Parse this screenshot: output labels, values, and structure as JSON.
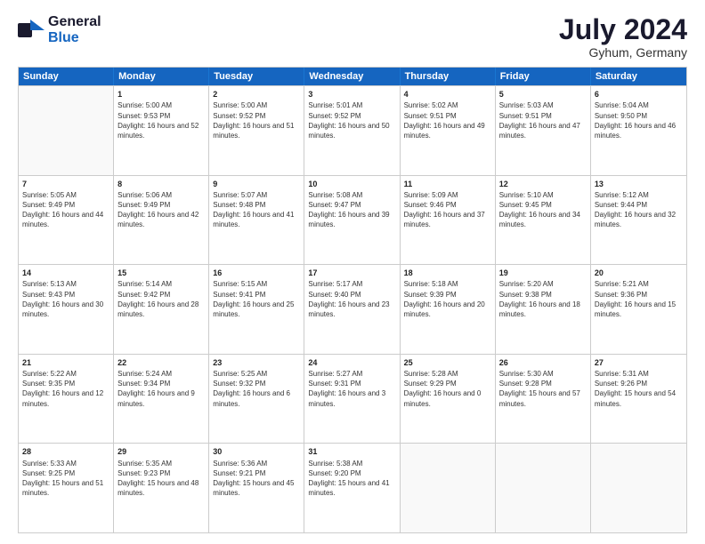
{
  "header": {
    "logo_general": "General",
    "logo_blue": "Blue",
    "month_title": "July 2024",
    "location": "Gyhum, Germany"
  },
  "weekdays": [
    "Sunday",
    "Monday",
    "Tuesday",
    "Wednesday",
    "Thursday",
    "Friday",
    "Saturday"
  ],
  "rows": [
    [
      {
        "day": "",
        "sunrise": "",
        "sunset": "",
        "daylight": "",
        "empty": true
      },
      {
        "day": "1",
        "sunrise": "Sunrise: 5:00 AM",
        "sunset": "Sunset: 9:53 PM",
        "daylight": "Daylight: 16 hours and 52 minutes."
      },
      {
        "day": "2",
        "sunrise": "Sunrise: 5:00 AM",
        "sunset": "Sunset: 9:52 PM",
        "daylight": "Daylight: 16 hours and 51 minutes."
      },
      {
        "day": "3",
        "sunrise": "Sunrise: 5:01 AM",
        "sunset": "Sunset: 9:52 PM",
        "daylight": "Daylight: 16 hours and 50 minutes."
      },
      {
        "day": "4",
        "sunrise": "Sunrise: 5:02 AM",
        "sunset": "Sunset: 9:51 PM",
        "daylight": "Daylight: 16 hours and 49 minutes."
      },
      {
        "day": "5",
        "sunrise": "Sunrise: 5:03 AM",
        "sunset": "Sunset: 9:51 PM",
        "daylight": "Daylight: 16 hours and 47 minutes."
      },
      {
        "day": "6",
        "sunrise": "Sunrise: 5:04 AM",
        "sunset": "Sunset: 9:50 PM",
        "daylight": "Daylight: 16 hours and 46 minutes."
      }
    ],
    [
      {
        "day": "7",
        "sunrise": "Sunrise: 5:05 AM",
        "sunset": "Sunset: 9:49 PM",
        "daylight": "Daylight: 16 hours and 44 minutes."
      },
      {
        "day": "8",
        "sunrise": "Sunrise: 5:06 AM",
        "sunset": "Sunset: 9:49 PM",
        "daylight": "Daylight: 16 hours and 42 minutes."
      },
      {
        "day": "9",
        "sunrise": "Sunrise: 5:07 AM",
        "sunset": "Sunset: 9:48 PM",
        "daylight": "Daylight: 16 hours and 41 minutes."
      },
      {
        "day": "10",
        "sunrise": "Sunrise: 5:08 AM",
        "sunset": "Sunset: 9:47 PM",
        "daylight": "Daylight: 16 hours and 39 minutes."
      },
      {
        "day": "11",
        "sunrise": "Sunrise: 5:09 AM",
        "sunset": "Sunset: 9:46 PM",
        "daylight": "Daylight: 16 hours and 37 minutes."
      },
      {
        "day": "12",
        "sunrise": "Sunrise: 5:10 AM",
        "sunset": "Sunset: 9:45 PM",
        "daylight": "Daylight: 16 hours and 34 minutes."
      },
      {
        "day": "13",
        "sunrise": "Sunrise: 5:12 AM",
        "sunset": "Sunset: 9:44 PM",
        "daylight": "Daylight: 16 hours and 32 minutes."
      }
    ],
    [
      {
        "day": "14",
        "sunrise": "Sunrise: 5:13 AM",
        "sunset": "Sunset: 9:43 PM",
        "daylight": "Daylight: 16 hours and 30 minutes."
      },
      {
        "day": "15",
        "sunrise": "Sunrise: 5:14 AM",
        "sunset": "Sunset: 9:42 PM",
        "daylight": "Daylight: 16 hours and 28 minutes."
      },
      {
        "day": "16",
        "sunrise": "Sunrise: 5:15 AM",
        "sunset": "Sunset: 9:41 PM",
        "daylight": "Daylight: 16 hours and 25 minutes."
      },
      {
        "day": "17",
        "sunrise": "Sunrise: 5:17 AM",
        "sunset": "Sunset: 9:40 PM",
        "daylight": "Daylight: 16 hours and 23 minutes."
      },
      {
        "day": "18",
        "sunrise": "Sunrise: 5:18 AM",
        "sunset": "Sunset: 9:39 PM",
        "daylight": "Daylight: 16 hours and 20 minutes."
      },
      {
        "day": "19",
        "sunrise": "Sunrise: 5:20 AM",
        "sunset": "Sunset: 9:38 PM",
        "daylight": "Daylight: 16 hours and 18 minutes."
      },
      {
        "day": "20",
        "sunrise": "Sunrise: 5:21 AM",
        "sunset": "Sunset: 9:36 PM",
        "daylight": "Daylight: 16 hours and 15 minutes."
      }
    ],
    [
      {
        "day": "21",
        "sunrise": "Sunrise: 5:22 AM",
        "sunset": "Sunset: 9:35 PM",
        "daylight": "Daylight: 16 hours and 12 minutes."
      },
      {
        "day": "22",
        "sunrise": "Sunrise: 5:24 AM",
        "sunset": "Sunset: 9:34 PM",
        "daylight": "Daylight: 16 hours and 9 minutes."
      },
      {
        "day": "23",
        "sunrise": "Sunrise: 5:25 AM",
        "sunset": "Sunset: 9:32 PM",
        "daylight": "Daylight: 16 hours and 6 minutes."
      },
      {
        "day": "24",
        "sunrise": "Sunrise: 5:27 AM",
        "sunset": "Sunset: 9:31 PM",
        "daylight": "Daylight: 16 hours and 3 minutes."
      },
      {
        "day": "25",
        "sunrise": "Sunrise: 5:28 AM",
        "sunset": "Sunset: 9:29 PM",
        "daylight": "Daylight: 16 hours and 0 minutes."
      },
      {
        "day": "26",
        "sunrise": "Sunrise: 5:30 AM",
        "sunset": "Sunset: 9:28 PM",
        "daylight": "Daylight: 15 hours and 57 minutes."
      },
      {
        "day": "27",
        "sunrise": "Sunrise: 5:31 AM",
        "sunset": "Sunset: 9:26 PM",
        "daylight": "Daylight: 15 hours and 54 minutes."
      }
    ],
    [
      {
        "day": "28",
        "sunrise": "Sunrise: 5:33 AM",
        "sunset": "Sunset: 9:25 PM",
        "daylight": "Daylight: 15 hours and 51 minutes."
      },
      {
        "day": "29",
        "sunrise": "Sunrise: 5:35 AM",
        "sunset": "Sunset: 9:23 PM",
        "daylight": "Daylight: 15 hours and 48 minutes."
      },
      {
        "day": "30",
        "sunrise": "Sunrise: 5:36 AM",
        "sunset": "Sunset: 9:21 PM",
        "daylight": "Daylight: 15 hours and 45 minutes."
      },
      {
        "day": "31",
        "sunrise": "Sunrise: 5:38 AM",
        "sunset": "Sunset: 9:20 PM",
        "daylight": "Daylight: 15 hours and 41 minutes."
      },
      {
        "day": "",
        "sunrise": "",
        "sunset": "",
        "daylight": "",
        "empty": true
      },
      {
        "day": "",
        "sunrise": "",
        "sunset": "",
        "daylight": "",
        "empty": true
      },
      {
        "day": "",
        "sunrise": "",
        "sunset": "",
        "daylight": "",
        "empty": true
      }
    ]
  ]
}
